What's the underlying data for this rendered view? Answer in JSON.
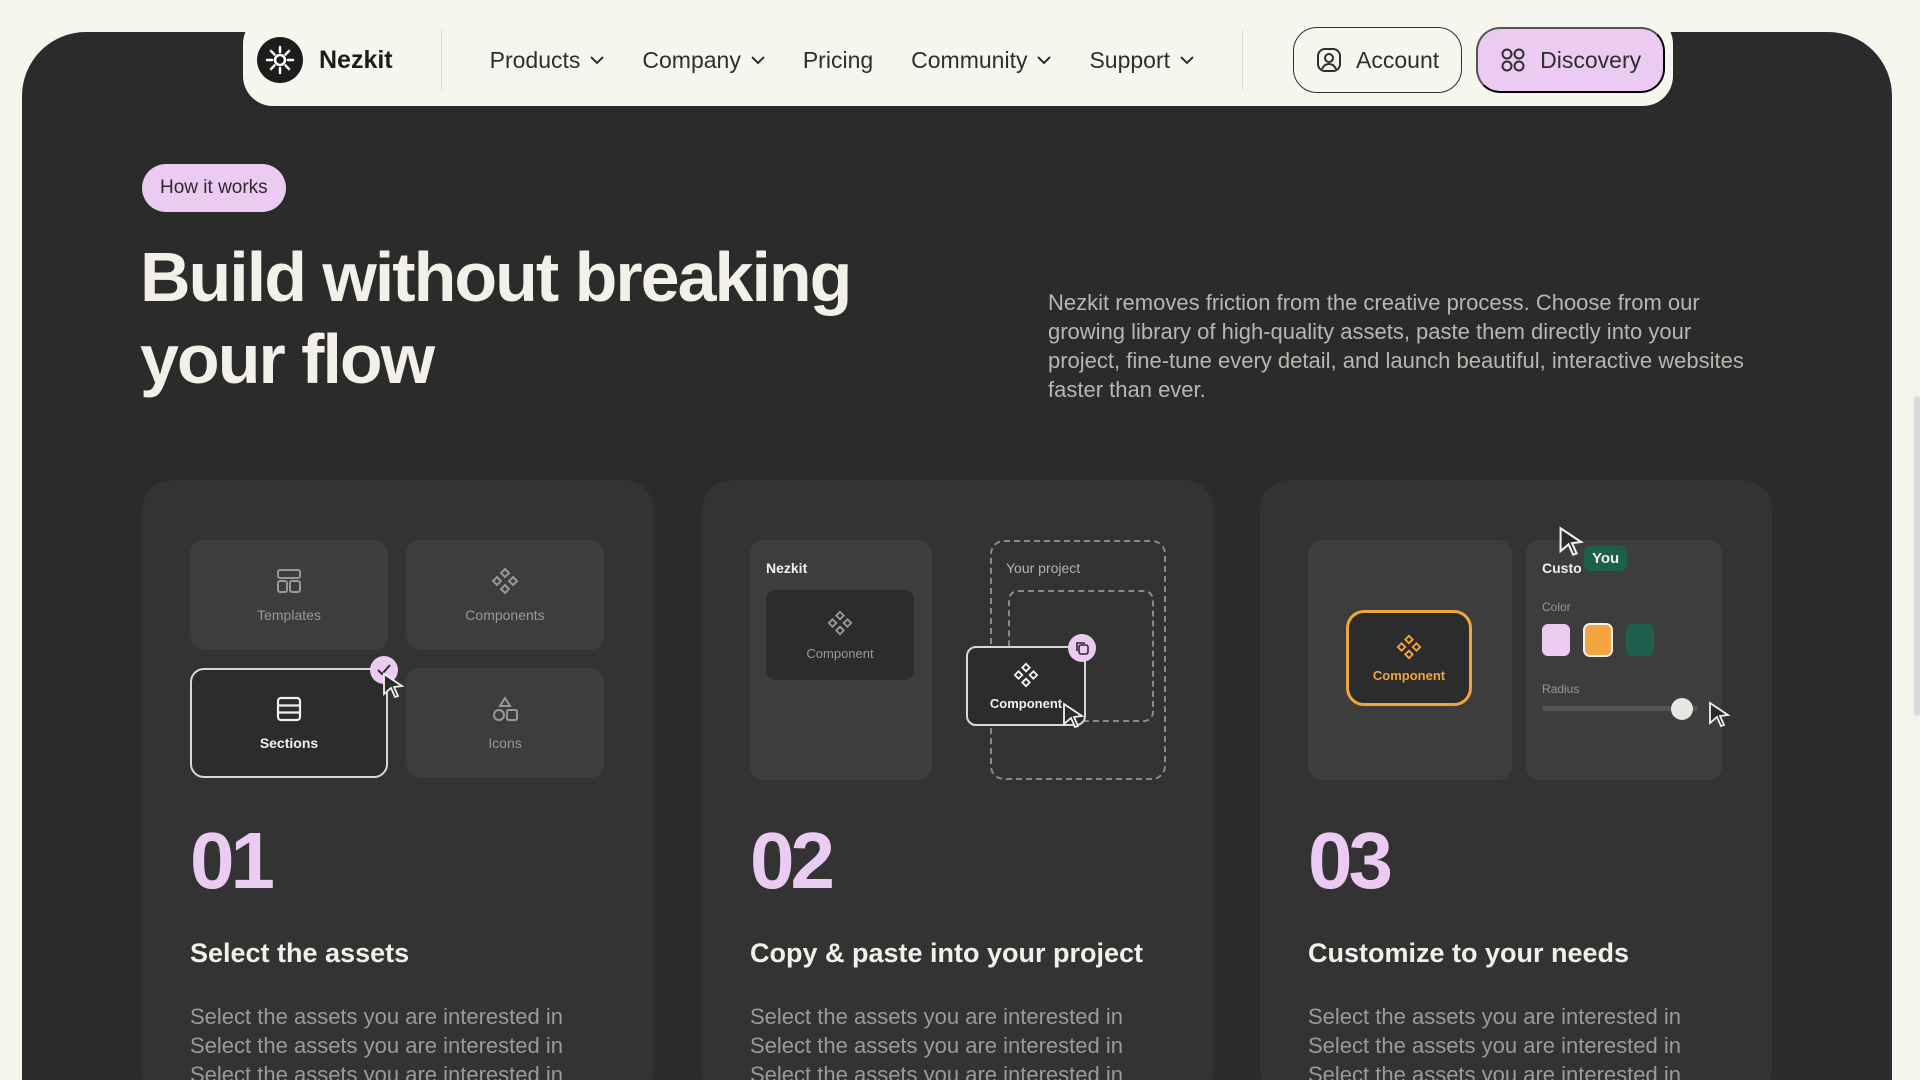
{
  "nav": {
    "brand": "Nezkit",
    "links": [
      {
        "label": "Products",
        "dropdown": true
      },
      {
        "label": "Company",
        "dropdown": true
      },
      {
        "label": "Pricing",
        "dropdown": false
      },
      {
        "label": "Community",
        "dropdown": true
      },
      {
        "label": "Support",
        "dropdown": true
      }
    ],
    "account_label": "Account",
    "discovery_label": "Discovery"
  },
  "hero": {
    "badge": "How it works",
    "title_line1": "Build without breaking",
    "title_line2": "your flow",
    "description": "Nezkit removes friction from the creative process. Choose from our growing library of high-quality assets, paste them directly into your project, fine-tune every detail, and launch beautiful, interactive websites faster than ever."
  },
  "steps": [
    {
      "number": "01",
      "title": "Select the assets",
      "description": "Select the assets you are interested in Select the assets you are interested in Select the assets you are interested in",
      "tiles": [
        "Templates",
        "Components",
        "Sections",
        "Icons"
      ]
    },
    {
      "number": "02",
      "title": "Copy & paste into your project",
      "description": "Select the assets you are interested in Select the assets you are interested in Select the assets you are interested in",
      "library_label": "Nezkit",
      "library_component": "Component",
      "project_label": "Your project",
      "dragged_component": "Component"
    },
    {
      "number": "03",
      "title": "Customize to your needs",
      "description": "Select the assets you are interested in Select the assets you are interested in Select the assets you are interested in",
      "preview_component": "Component",
      "panel_title": "Custo",
      "user_tag": "You",
      "color_label": "Color",
      "radius_label": "Radius",
      "radius_value": 0.85,
      "swatches": [
        "#eccbf2",
        "#f2a440",
        "#1d5e4c"
      ]
    }
  ],
  "colors": {
    "accent": "#eccbf2",
    "dark": "#2b2b2b",
    "orange": "#f2a440",
    "green": "#1d5e4c"
  }
}
